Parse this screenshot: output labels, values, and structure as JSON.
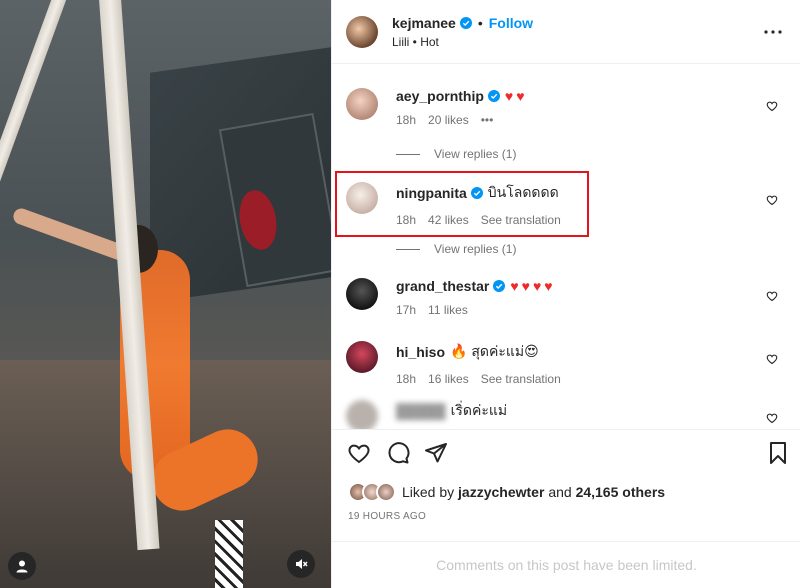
{
  "post": {
    "author": "kejmanee",
    "follow_label": "Follow",
    "separator": "•",
    "subtitle": "Liili • Hot"
  },
  "comments": [
    {
      "user": "aey_pornthip",
      "text": "♥♥",
      "time": "18h",
      "likes": "20 likes",
      "extra": "•••",
      "replies": "View replies (1)"
    },
    {
      "user": "ningpanita",
      "text": "บินโลดดดด",
      "time": "18h",
      "likes": "42 likes",
      "extra": "See translation",
      "replies": "View replies (1)"
    },
    {
      "user": "grand_thestar",
      "text": "♥♥♥♥",
      "time": "17h",
      "likes": "11 likes"
    },
    {
      "user": "hi_hiso",
      "text": "🔥 สุดค่ะแม่😍",
      "time": "18h",
      "likes": "16 likes",
      "extra": "See translation"
    },
    {
      "user": "█████",
      "text": "เริ่ดค่ะแม่"
    }
  ],
  "likes": {
    "prefix": "Liked by",
    "user": "jazzychewter",
    "conj": "and",
    "others": "24,165 others"
  },
  "timestamp": "19 HOURS AGO",
  "limited_notice": "Comments on this post have been limited.",
  "icons": {
    "more": "more-horizontal-icon",
    "like": "heart-icon",
    "comment": "comment-bubble-icon",
    "share": "paper-plane-icon",
    "save": "bookmark-icon",
    "user": "user-tag-icon",
    "mute": "muted-speaker-icon"
  },
  "colors": {
    "link": "#0095f6",
    "heart": "#ed2b2b",
    "highlight": "#e5121b",
    "secondary_text": "#737373"
  }
}
